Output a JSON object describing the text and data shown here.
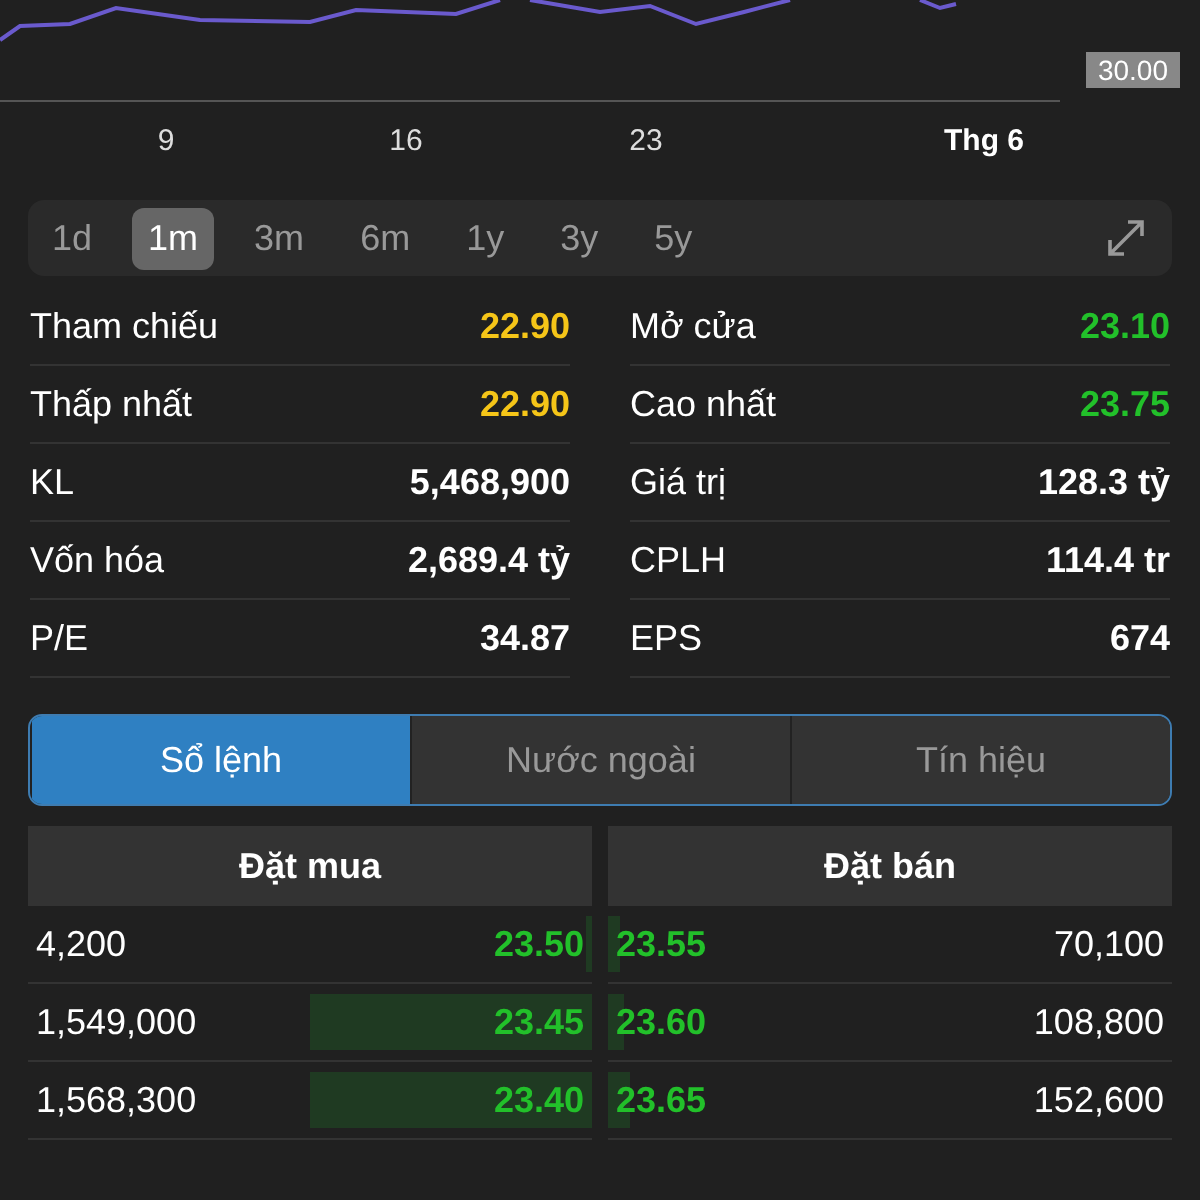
{
  "chart": {
    "price_tag": "30.00",
    "x_labels": [
      {
        "label": "9",
        "bold": false
      },
      {
        "label": "16",
        "bold": false
      },
      {
        "label": "23",
        "bold": false
      },
      {
        "label": "Thg 6",
        "bold": true
      }
    ]
  },
  "ranges": [
    {
      "label": "1d",
      "selected": false
    },
    {
      "label": "1m",
      "selected": true
    },
    {
      "label": "3m",
      "selected": false
    },
    {
      "label": "6m",
      "selected": false
    },
    {
      "label": "1y",
      "selected": false
    },
    {
      "label": "3y",
      "selected": false
    },
    {
      "label": "5y",
      "selected": false
    }
  ],
  "stats": [
    {
      "label": "Tham chiếu",
      "value": "22.90",
      "color": "#f5c518"
    },
    {
      "label": "Mở cửa",
      "value": "23.10",
      "color": "#22c02a"
    },
    {
      "label": "Thấp nhất",
      "value": "22.90",
      "color": "#f5c518"
    },
    {
      "label": "Cao nhất",
      "value": "23.75",
      "color": "#22c02a"
    },
    {
      "label": "KL",
      "value": "5,468,900",
      "color": "#ffffff"
    },
    {
      "label": "Giá trị",
      "value": "128.3 tỷ",
      "color": "#ffffff"
    },
    {
      "label": "Vốn hóa",
      "value": "2,689.4 tỷ",
      "color": "#ffffff"
    },
    {
      "label": "CPLH",
      "value": "114.4 tr",
      "color": "#ffffff"
    },
    {
      "label": "P/E",
      "value": "34.87",
      "color": "#ffffff"
    },
    {
      "label": "EPS",
      "value": "674",
      "color": "#ffffff"
    }
  ],
  "tabs": [
    {
      "label": "Sổ lệnh",
      "selected": true
    },
    {
      "label": "Nước ngoài",
      "selected": false
    },
    {
      "label": "Tín hiệu",
      "selected": false
    }
  ],
  "order_book": {
    "buy_header": "Đặt mua",
    "sell_header": "Đặt bán",
    "rows": [
      {
        "buy": {
          "volume": "4,200",
          "price": "23.50",
          "level": 0.01
        },
        "sell": {
          "price": "23.55",
          "level": 0.02,
          "volume": "70,100"
        }
      },
      {
        "buy": {
          "volume": "1,549,000",
          "price": "23.45",
          "level": 0.5
        },
        "sell": {
          "price": "23.60",
          "level": 0.03,
          "volume": "108,800"
        }
      },
      {
        "buy": {
          "volume": "1,568,300",
          "price": "23.40",
          "level": 0.5
        },
        "sell": {
          "price": "23.65",
          "level": 0.04,
          "volume": "152,600"
        }
      }
    ]
  }
}
